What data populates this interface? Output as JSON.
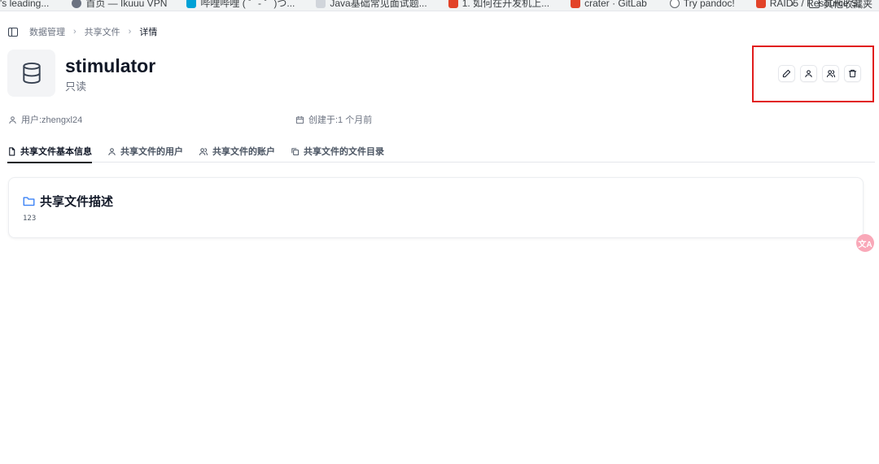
{
  "bookmarks": [
    {
      "label": "'s leading...",
      "color": "#5f6368"
    },
    {
      "label": "首页 — Ikuuu VPN",
      "color": "#6b7280"
    },
    {
      "label": "哔哩哔哩 ( ゜- ゜)つ...",
      "color": "#00a1d6"
    },
    {
      "label": "Java基础常见面试题...",
      "color": "#9ca3af"
    },
    {
      "label": "1. 如何在开发机上...",
      "color": "#e24329"
    },
    {
      "label": "crater · GitLab",
      "color": "#e24329"
    },
    {
      "label": "Try pandoc!",
      "color": "#5f6368"
    },
    {
      "label": "RAID5 / Resource S...",
      "color": "#e24329"
    }
  ],
  "bookmarks_right": {
    "chevron": "›",
    "other_label": "其他收藏夹"
  },
  "breadcrumb": {
    "items": [
      "数据管理",
      "共享文件"
    ],
    "current": "详情"
  },
  "header": {
    "title": "stimulator",
    "subtitle": "只读",
    "icon": "database-icon"
  },
  "actions": [
    {
      "name": "edit-button",
      "icon": "pencil-icon"
    },
    {
      "name": "user-button",
      "icon": "user-icon"
    },
    {
      "name": "users-button",
      "icon": "users-icon"
    },
    {
      "name": "delete-button",
      "icon": "trash-icon"
    }
  ],
  "meta": {
    "user": "用户:zhengxl24",
    "created": "创建于:1 个月前"
  },
  "tabs": [
    {
      "label": "共享文件基本信息",
      "icon": "file-icon",
      "active": true
    },
    {
      "label": "共享文件的用户",
      "icon": "user-icon",
      "active": false
    },
    {
      "label": "共享文件的账户",
      "icon": "users-icon",
      "active": false
    },
    {
      "label": "共享文件的文件目录",
      "icon": "copy-icon",
      "active": false
    }
  ],
  "card": {
    "title": "共享文件描述",
    "body": "123",
    "icon": "folder-icon"
  },
  "float_button": {
    "label": "文A",
    "color": "#f9a8b8"
  },
  "colors": {
    "highlight": "#e11d1d",
    "folder_icon": "#3b82f6"
  }
}
